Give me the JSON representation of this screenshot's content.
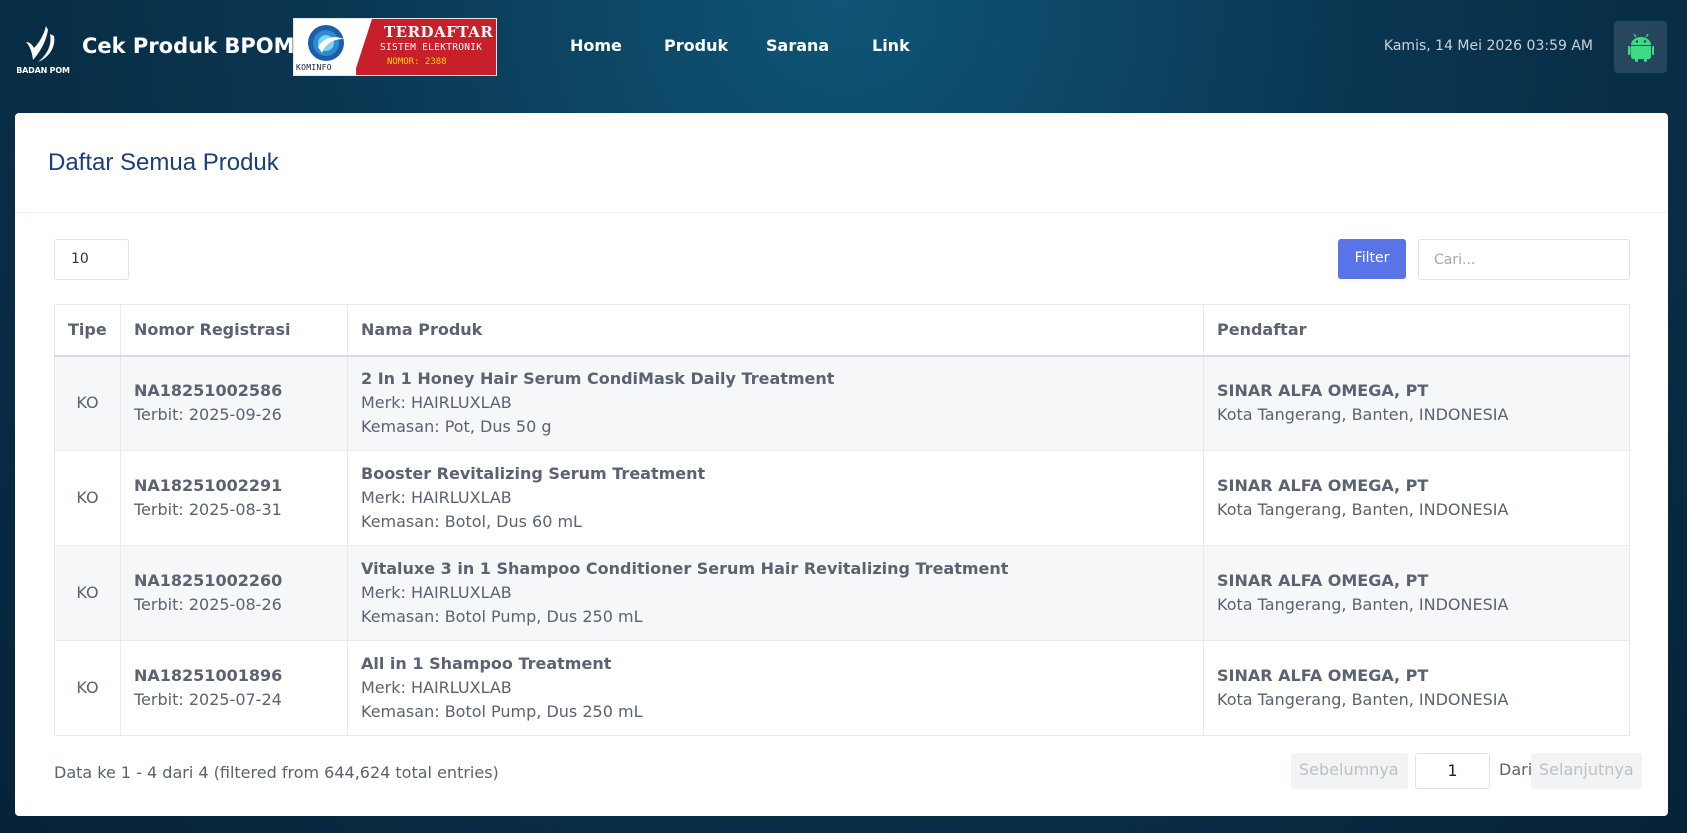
{
  "header": {
    "logo_text": "BADAN POM",
    "brand": "Cek Produk BPOM",
    "kominfo": {
      "name": "KOMINFO",
      "line1": "TERDAFTAR",
      "line2": "SISTEM ELEKTRONIK",
      "line3": "NOMOR: 2388"
    },
    "nav": [
      "Home",
      "Produk",
      "Sarana",
      "Link"
    ],
    "datetime": "Kamis, 14 Mei 2026 03:59 AM",
    "android_icon": "android-icon"
  },
  "card": {
    "title": "Daftar Semua Produk",
    "page_length": "10",
    "filter_label": "Filter",
    "search_placeholder": "Cari..."
  },
  "table": {
    "columns": [
      "Tipe",
      "Nomor Registrasi",
      "Nama Produk",
      "Pendaftar"
    ],
    "rows": [
      {
        "tipe": "KO",
        "nomor": "NA18251002586",
        "terbit": "Terbit: 2025-09-26",
        "nama": "2 In 1 Honey Hair Serum CondiMask Daily Treatment",
        "merk": "Merk: HAIRLUXLAB",
        "kemasan": "Kemasan: Pot, Dus 50 g",
        "pendaftar": "SINAR ALFA OMEGA, PT",
        "lokasi": "Kota Tangerang, Banten, INDONESIA"
      },
      {
        "tipe": "KO",
        "nomor": "NA18251002291",
        "terbit": "Terbit: 2025-08-31",
        "nama": "Booster Revitalizing Serum Treatment",
        "merk": "Merk: HAIRLUXLAB",
        "kemasan": "Kemasan: Botol, Dus 60 mL",
        "pendaftar": "SINAR ALFA OMEGA, PT",
        "lokasi": "Kota Tangerang, Banten, INDONESIA"
      },
      {
        "tipe": "KO",
        "nomor": "NA18251002260",
        "terbit": "Terbit: 2025-08-26",
        "nama": "Vitaluxe 3 in 1 Shampoo Conditioner Serum Hair Revitalizing Treatment",
        "merk": "Merk: HAIRLUXLAB",
        "kemasan": "Kemasan: Botol Pump, Dus 250 mL",
        "pendaftar": "SINAR ALFA OMEGA, PT",
        "lokasi": "Kota Tangerang, Banten, INDONESIA"
      },
      {
        "tipe": "KO",
        "nomor": "NA18251001896",
        "terbit": "Terbit: 2025-07-24",
        "nama": "All in 1 Shampoo Treatment",
        "merk": "Merk: HAIRLUXLAB",
        "kemasan": "Kemasan: Botol Pump, Dus 250 mL",
        "pendaftar": "SINAR ALFA OMEGA, PT",
        "lokasi": "Kota Tangerang, Banten, INDONESIA"
      }
    ]
  },
  "footer": {
    "info": "Data ke 1 - 4 dari 4 (filtered from 644,624 total entries)",
    "prev": "Sebelumnya",
    "page": "1",
    "of": "Dari: 1",
    "next": "Selanjutnya"
  },
  "colors": {
    "accent": "#5874e6",
    "title": "#1b3f78",
    "android": "#3ddc84",
    "kominfo_red": "#c8202b"
  }
}
